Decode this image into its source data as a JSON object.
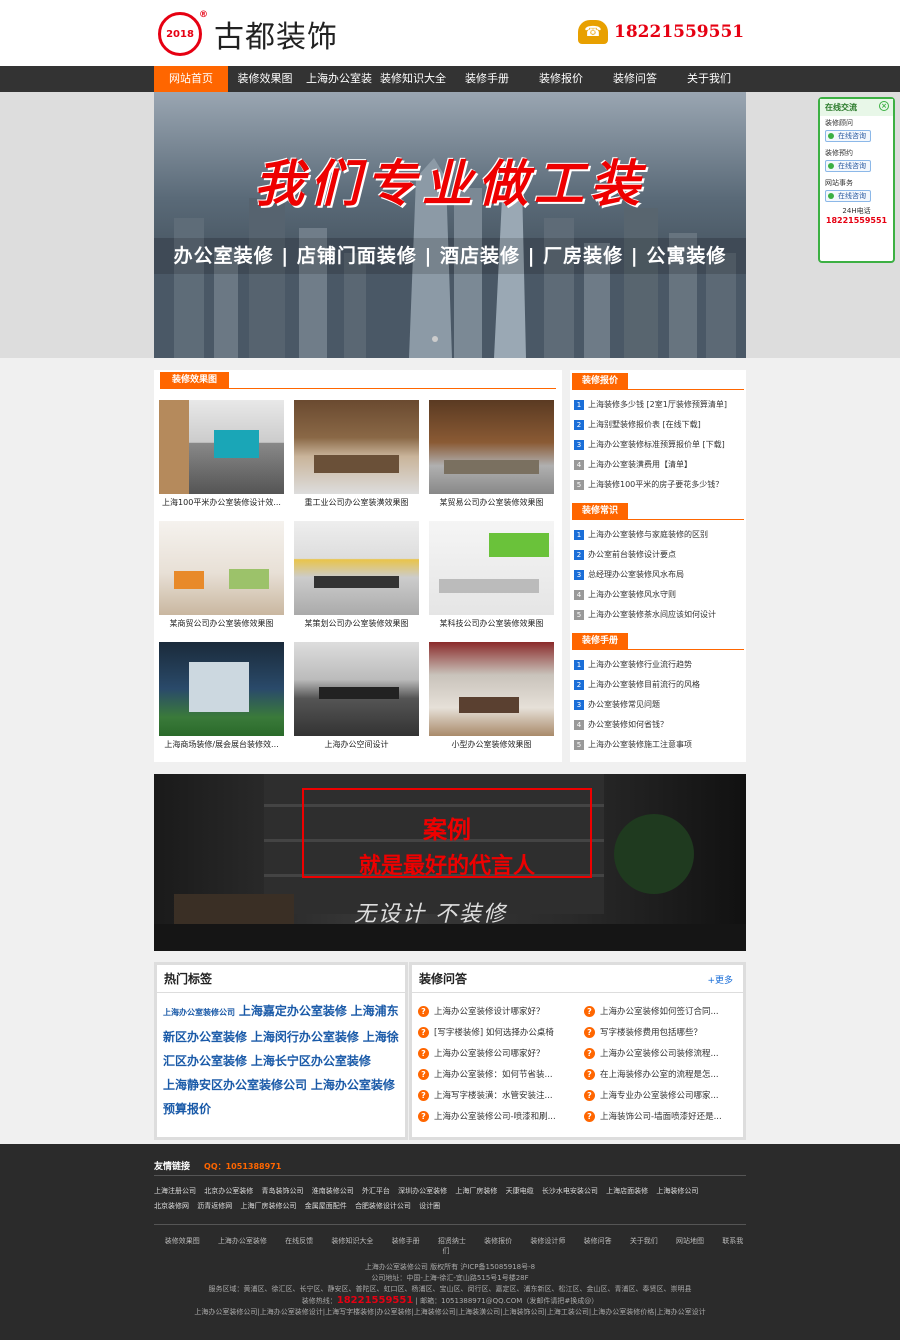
{
  "header": {
    "logo_badge": "2018",
    "logo_reg": "®",
    "logo_text": "古都装饰",
    "phone": "18221559551"
  },
  "nav": [
    "网站首页",
    "装修效果图",
    "上海办公室装修",
    "装修知识大全",
    "装修手册",
    "装修报价",
    "装修问答",
    "关于我们"
  ],
  "banner": {
    "title": "我们专业做工装",
    "subtitle": "办公室装修 | 店铺门面装修 | 酒店装修 | 厂房装修 | 公寓装修"
  },
  "float_panel": {
    "title": "在线交流",
    "items": [
      {
        "label": "装修顾问",
        "btn": "在线咨询"
      },
      {
        "label": "装修预约",
        "btn": "在线咨询"
      },
      {
        "label": "网站事务",
        "btn": "在线咨询"
      }
    ],
    "phone_label": "24H电话",
    "phone": "18221559551"
  },
  "gallery": {
    "title": "装修效果图",
    "items": [
      "上海100平米办公室装修设计效...",
      "重工业公司办公室装潢效果图",
      "某贸易公司办公室装修效果图",
      "某商贸公司办公室装修效果图",
      "某策划公司办公室装修效果图",
      "某科技公司办公室装修效果图",
      "上海商场装修/展会展台装修效...",
      "上海办公空间设计",
      "小型办公室装修效果图"
    ]
  },
  "sidebar": [
    {
      "title": "装修报价",
      "items": [
        "上海装修多少钱 [2室1厅装修预算清单]",
        "上海别墅装修报价表 [在线下载]",
        "上海办公室装修标准预算报价单 [下载]",
        "上海办公室装潢费用【清单】",
        "上海装修100平米的房子要花多少钱？"
      ]
    },
    {
      "title": "装修常识",
      "items": [
        "上海办公室装修与家庭装修的区别",
        "办公室前台装修设计要点",
        "总经理办公室装修风水布局",
        "上海办公室装修风水守则",
        "上海办公室装修茶水间应该如何设计"
      ]
    },
    {
      "title": "装修手册",
      "items": [
        "上海办公室装修行业流行趋势",
        "上海办公室装修目前流行的风格",
        "办公室装修常见问题",
        "办公室装修如何省钱？",
        "上海办公室装修施工注意事项"
      ]
    }
  ],
  "case_banner": {
    "line1": "案例",
    "line2": "就是最好的代言人",
    "line3": "无设计 不装修"
  },
  "tags": {
    "title": "热门标签",
    "items": [
      "上海办公室装修公司",
      "上海嘉定办公室装修",
      "上海浦东新区办公室装修",
      "上海闵行办公室装修",
      "上海徐汇区办公室装修",
      "上海长宁区办公室装修",
      "上海静安区办公室装修公司",
      "上海办公室装修预算报价"
    ]
  },
  "qa": {
    "title": "装修问答",
    "more": "+更多",
    "items": [
      "上海办公室装修设计哪家好？",
      "上海办公室装修如何签订合同...",
      "[写字楼装修] 如何选择办公桌椅",
      "写字楼装修费用包括哪些？",
      "上海办公室装修公司哪家好？",
      "上海办公室装修公司装修流程...",
      "上海办公室装修：如何节省装...",
      "在上海装修办公室的流程是怎...",
      "上海写字楼装潢：水管安装注...",
      "上海专业办公室装修公司哪家...",
      "上海办公室装修公司-喷漆和刷...",
      "上海装饰公司-墙面喷漆好还是..."
    ]
  },
  "footer": {
    "links_title": "友情链接",
    "qq": "QQ：1051388971",
    "links": [
      "上海注册公司",
      "北京办公室装修",
      "青岛装饰公司",
      "淮南装修公司",
      "外汇平台",
      "深圳办公室装修",
      "上海厂房装修",
      "天康电缆",
      "长沙水电安装公司",
      "上海店面装修",
      "上海装修公司",
      "北京装修网",
      "沥青返修网",
      "上海厂房装修公司",
      "金属屋面配件",
      "合肥装修设计公司",
      "设计圈"
    ],
    "nav": [
      "装修效果图",
      "上海办公室装修",
      "在线反馈",
      "装修知识大全",
      "装修手册",
      "招贤纳士",
      "装修报价",
      "装修设计师",
      "装修问答",
      "关于我们",
      "网站地图",
      "联系我们"
    ],
    "copyright": "上海办公室装修公司 版权所有 沪ICP备15085918号-8",
    "address": "公司地址：中国-上海-徐汇-宜山路515号1号楼28F",
    "areas": "服务区域：黄浦区、徐汇区、长宁区、静安区、普陀区、虹口区、杨浦区、宝山区、闵行区、嘉定区、浦东新区、松江区、金山区、青浦区、奉贤区、崇明县",
    "hotline_label": "装修热线：",
    "hotline": "18221559551",
    "email": "| 邮箱：1051388971@QQ.COM（发邮件请把#换成@）",
    "bottom": "上海办公室装修公司|上海办公室装修设计|上海写字楼装修|办公室装修|上海装修公司|上海装潢公司|上海装饰公司|上海工装公司|上海办公室装修价格|上海办公室设计"
  }
}
